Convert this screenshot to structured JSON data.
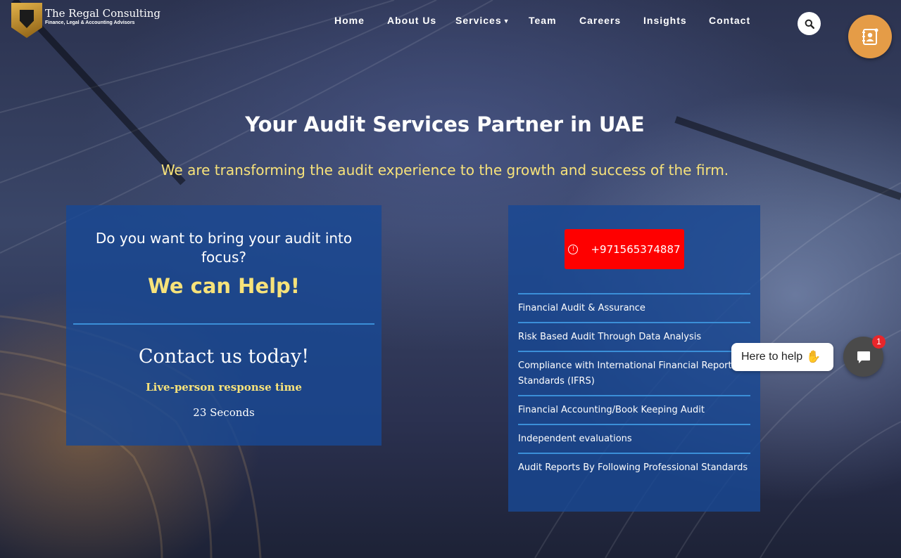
{
  "header": {
    "logo": {
      "name": "The Regal Consulting",
      "tagline": "Finance, Legal & Accounting Advisors"
    },
    "nav": [
      {
        "label": "Home"
      },
      {
        "label": "About Us"
      },
      {
        "label": "Services",
        "has_dropdown": true
      },
      {
        "label": "Team"
      },
      {
        "label": "Careers"
      },
      {
        "label": "Insights"
      },
      {
        "label": "Contact"
      }
    ],
    "search_icon": "search-icon",
    "contact_fab_icon": "contact-book-icon"
  },
  "hero": {
    "title": "Your Audit Services Partner in UAE",
    "subtitle": "We are transforming the audit experience to the growth and success of the firm."
  },
  "left_card": {
    "question": "Do you want to bring your audit into focus?",
    "help": "We can Help!",
    "contact": "Contact us today!",
    "response_label": "Live-person response time",
    "response_time": "23 Seconds"
  },
  "right_card": {
    "phone": "+971565374887",
    "phone_icon": "info-circle-icon",
    "services": [
      "Financial Audit & Assurance",
      "Risk Based Audit Through Data Analysis",
      "Compliance with International Financial Reporting Standards (IFRS)",
      "Financial Accounting/Book Keeping Audit",
      "Independent evaluations",
      "Audit Reports By Following Professional Standards"
    ]
  },
  "chat": {
    "prompt": "Here to help",
    "badge_count": "1"
  },
  "colors": {
    "accent_yellow": "#f6e27a",
    "card_blue": "#1848a0",
    "phone_red": "#fe0000",
    "fab_orange": "#e59c47",
    "divider_blue": "#3b8fd8"
  }
}
